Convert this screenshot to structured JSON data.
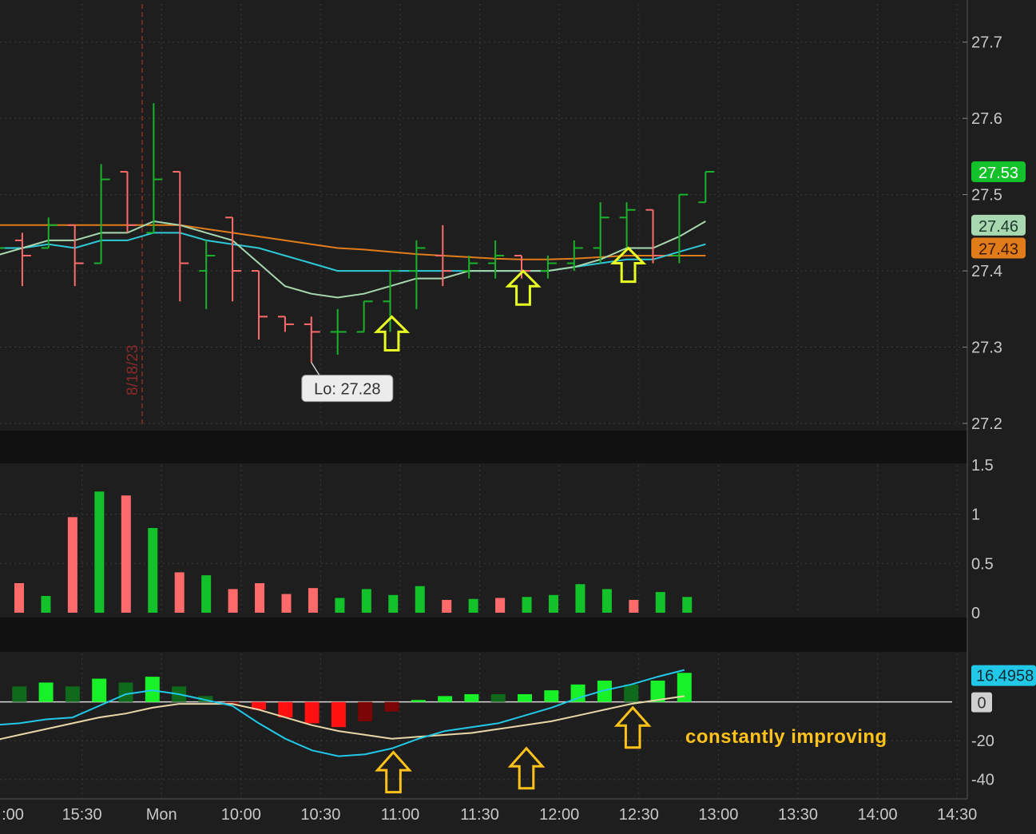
{
  "colors": {
    "background": "#1e1e1e",
    "separator": "#111111",
    "grid": "#3a3a3a",
    "up_bar": "#19b22a",
    "down_bar": "#ff6b6b",
    "ma_orange": "#e07c1a",
    "ma_cyan": "#2ec9d8",
    "ma_light": "#a8d8b0",
    "vol_up": "#13c22a",
    "vol_down": "#ff6b6b",
    "osc_bright_up": "#18f028",
    "osc_dark_up": "#0f6a1c",
    "osc_bright_down": "#ff1111",
    "osc_dark_down": "#7a0606",
    "osc_cyan": "#22c8e8",
    "osc_tan": "#e8d8a8",
    "arrow_yellow": "#e8ff24",
    "arrow_orange": "#ffc21a",
    "annotation_text": "#ffc21a",
    "axis_text": "#c8c8c8",
    "session_line": "#c0392b"
  },
  "time_axis": {
    "labels": [
      ":00",
      "15:30",
      "Mon",
      "10:00",
      "10:30",
      "11:00",
      "11:30",
      "12:00",
      "12:30",
      "13:00",
      "13:30",
      "14:00",
      "14:30"
    ]
  },
  "session_marker": {
    "label": "8/18/23",
    "icon": "session-divider"
  },
  "chart_data": [
    {
      "type": "ohlc",
      "panel": "price",
      "ylim": [
        27.2,
        27.75
      ],
      "y_ticks": [
        "27.7",
        "27.6",
        "27.5",
        "27.4",
        "27.3",
        "27.2"
      ],
      "bars": [
        {
          "o": 27.42,
          "h": 27.44,
          "l": 27.41,
          "c": 27.43,
          "dir": "up"
        },
        {
          "o": 27.44,
          "h": 27.45,
          "l": 27.38,
          "c": 27.42,
          "dir": "down"
        },
        {
          "o": 27.43,
          "h": 27.47,
          "l": 27.43,
          "c": 27.46,
          "dir": "up"
        },
        {
          "o": 27.46,
          "h": 27.46,
          "l": 27.38,
          "c": 27.41,
          "dir": "down"
        },
        {
          "o": 27.41,
          "h": 27.54,
          "l": 27.41,
          "c": 27.52,
          "dir": "up"
        },
        {
          "o": 27.53,
          "h": 27.53,
          "l": 27.45,
          "c": 27.46,
          "dir": "down"
        },
        {
          "o": 27.45,
          "h": 27.62,
          "l": 27.45,
          "c": 27.52,
          "dir": "up"
        },
        {
          "o": 27.53,
          "h": 27.53,
          "l": 27.36,
          "c": 27.41,
          "dir": "down"
        },
        {
          "o": 27.4,
          "h": 27.44,
          "l": 27.35,
          "c": 27.42,
          "dir": "up"
        },
        {
          "o": 27.47,
          "h": 27.47,
          "l": 27.36,
          "c": 27.4,
          "dir": "down"
        },
        {
          "o": 27.4,
          "h": 27.4,
          "l": 27.31,
          "c": 27.34,
          "dir": "down"
        },
        {
          "o": 27.34,
          "h": 27.34,
          "l": 27.32,
          "c": 27.33,
          "dir": "down"
        },
        {
          "o": 27.33,
          "h": 27.34,
          "l": 27.28,
          "c": 27.32,
          "dir": "down"
        },
        {
          "o": 27.32,
          "h": 27.35,
          "l": 27.29,
          "c": 27.32,
          "dir": "up"
        },
        {
          "o": 27.32,
          "h": 27.36,
          "l": 27.32,
          "c": 27.36,
          "dir": "up"
        },
        {
          "o": 27.36,
          "h": 27.4,
          "l": 27.32,
          "c": 27.4,
          "dir": "up"
        },
        {
          "o": 27.4,
          "h": 27.44,
          "l": 27.35,
          "c": 27.43,
          "dir": "up"
        },
        {
          "o": 27.42,
          "h": 27.46,
          "l": 27.38,
          "c": 27.4,
          "dir": "down"
        },
        {
          "o": 27.4,
          "h": 27.42,
          "l": 27.39,
          "c": 27.41,
          "dir": "up"
        },
        {
          "o": 27.41,
          "h": 27.44,
          "l": 27.39,
          "c": 27.42,
          "dir": "up"
        },
        {
          "o": 27.42,
          "h": 27.42,
          "l": 27.39,
          "c": 27.4,
          "dir": "down"
        },
        {
          "o": 27.4,
          "h": 27.42,
          "l": 27.39,
          "c": 27.41,
          "dir": "up"
        },
        {
          "o": 27.41,
          "h": 27.44,
          "l": 27.4,
          "c": 27.43,
          "dir": "up"
        },
        {
          "o": 27.43,
          "h": 27.49,
          "l": 27.41,
          "c": 27.47,
          "dir": "up"
        },
        {
          "o": 27.47,
          "h": 27.49,
          "l": 27.43,
          "c": 27.48,
          "dir": "up"
        },
        {
          "o": 27.48,
          "h": 27.48,
          "l": 27.41,
          "c": 27.42,
          "dir": "down"
        },
        {
          "o": 27.42,
          "h": 27.5,
          "l": 27.41,
          "c": 27.5,
          "dir": "up"
        },
        {
          "o": 27.49,
          "h": 27.53,
          "l": 27.49,
          "c": 27.53,
          "dir": "up"
        }
      ],
      "moving_averages": [
        {
          "color_key": "ma_orange",
          "values": [
            27.46,
            27.46,
            27.46,
            27.46,
            27.46,
            27.46,
            27.46,
            27.46,
            27.455,
            27.45,
            27.445,
            27.44,
            27.435,
            27.43,
            27.428,
            27.425,
            27.422,
            27.42,
            27.418,
            27.416,
            27.415,
            27.415,
            27.416,
            27.418,
            27.42,
            27.42,
            27.42,
            27.42
          ]
        },
        {
          "color_key": "ma_cyan",
          "values": [
            27.43,
            27.43,
            27.435,
            27.43,
            27.44,
            27.44,
            27.45,
            27.45,
            27.44,
            27.435,
            27.43,
            27.42,
            27.41,
            27.4,
            27.4,
            27.4,
            27.4,
            27.4,
            27.4,
            27.4,
            27.4,
            27.4,
            27.405,
            27.41,
            27.415,
            27.415,
            27.425,
            27.435
          ]
        },
        {
          "color_key": "ma_light",
          "values": [
            27.42,
            27.43,
            27.44,
            27.44,
            27.45,
            27.45,
            27.465,
            27.46,
            27.45,
            27.44,
            27.41,
            27.38,
            27.37,
            27.365,
            27.37,
            27.38,
            27.39,
            27.39,
            27.4,
            27.4,
            27.4,
            27.4,
            27.405,
            27.415,
            27.43,
            27.43,
            27.445,
            27.465
          ]
        }
      ],
      "price_labels": [
        {
          "text": "27.53",
          "value": 27.53,
          "color_key": "vol_up"
        },
        {
          "text": "27.46",
          "value": 27.46,
          "color_key": "ma_light"
        },
        {
          "text": "27.43",
          "value": 27.43,
          "color_key": "ma_orange"
        }
      ],
      "callout": {
        "text": "Lo: 27.28",
        "bar_index": 12,
        "value": 27.28
      },
      "arrows": [
        {
          "bar_index": 15,
          "value": 27.3
        },
        {
          "bar_index": 20,
          "value": 27.36
        },
        {
          "bar_index": 24,
          "value": 27.39
        }
      ]
    },
    {
      "type": "bar",
      "panel": "volume",
      "ylim": [
        0,
        1.5
      ],
      "y_ticks": [
        "1.5",
        "1",
        "0.5",
        "0"
      ],
      "values": [
        0.3,
        0.17,
        0.97,
        1.23,
        1.19,
        0.86,
        0.41,
        0.38,
        0.24,
        0.3,
        0.19,
        0.25,
        0.15,
        0.24,
        0.18,
        0.27,
        0.13,
        0.14,
        0.15,
        0.16,
        0.18,
        0.29,
        0.24,
        0.13,
        0.21,
        0.16
      ],
      "direction": [
        "down",
        "up",
        "down",
        "up",
        "down",
        "up",
        "down",
        "up",
        "down",
        "down",
        "down",
        "down",
        "up",
        "up",
        "up",
        "up",
        "down",
        "up",
        "down",
        "up",
        "up",
        "up",
        "up",
        "down",
        "up",
        "up"
      ]
    },
    {
      "type": "histogram",
      "panel": "oscillator",
      "ylim": [
        -50,
        25
      ],
      "y_ticks": [
        "-20",
        "-40"
      ],
      "zero_label": "0",
      "value_label": "16.4958",
      "histogram": [
        {
          "v": 7,
          "c": "osc_bright_up"
        },
        {
          "v": 8,
          "c": "osc_dark_up"
        },
        {
          "v": 10,
          "c": "osc_bright_up"
        },
        {
          "v": 8,
          "c": "osc_dark_up"
        },
        {
          "v": 12,
          "c": "osc_bright_up"
        },
        {
          "v": 10,
          "c": "osc_dark_up"
        },
        {
          "v": 13,
          "c": "osc_bright_up"
        },
        {
          "v": 8,
          "c": "osc_dark_up"
        },
        {
          "v": 3,
          "c": "osc_dark_up"
        },
        {
          "v": -1,
          "c": "osc_dark_down"
        },
        {
          "v": -4,
          "c": "osc_bright_down"
        },
        {
          "v": -8,
          "c": "osc_bright_down"
        },
        {
          "v": -11,
          "c": "osc_bright_down"
        },
        {
          "v": -13,
          "c": "osc_bright_down"
        },
        {
          "v": -10,
          "c": "osc_dark_down"
        },
        {
          "v": -5,
          "c": "osc_dark_down"
        },
        {
          "v": 1,
          "c": "osc_bright_up"
        },
        {
          "v": 3,
          "c": "osc_bright_up"
        },
        {
          "v": 4,
          "c": "osc_bright_up"
        },
        {
          "v": 4,
          "c": "osc_dark_up"
        },
        {
          "v": 4,
          "c": "osc_bright_up"
        },
        {
          "v": 6,
          "c": "osc_bright_up"
        },
        {
          "v": 9,
          "c": "osc_bright_up"
        },
        {
          "v": 11,
          "c": "osc_bright_up"
        },
        {
          "v": 9,
          "c": "osc_dark_up"
        },
        {
          "v": 11,
          "c": "osc_bright_up"
        },
        {
          "v": 15,
          "c": "osc_bright_up"
        }
      ],
      "line1": [
        -12,
        -11,
        -9,
        -8,
        -2,
        4,
        6,
        4,
        1,
        -2,
        -11,
        -19,
        -25,
        -28,
        -27,
        -24,
        -19,
        -15,
        -13,
        -11,
        -7,
        -3,
        2,
        6,
        9,
        13,
        16.5
      ],
      "line2": [
        -20,
        -17,
        -14,
        -11,
        -8,
        -6,
        -3,
        -1,
        -1,
        -1,
        -4,
        -8,
        -12,
        -15,
        -17,
        -19,
        -18,
        -17,
        -16,
        -14,
        -12,
        -10,
        -7,
        -4,
        -1,
        1,
        3
      ],
      "arrows": [
        {
          "bar_index": 15,
          "value": -35
        },
        {
          "bar_index": 20,
          "value": -33
        },
        {
          "bar_index": 24,
          "value": -12
        }
      ],
      "annotation": "constantly improving"
    }
  ]
}
